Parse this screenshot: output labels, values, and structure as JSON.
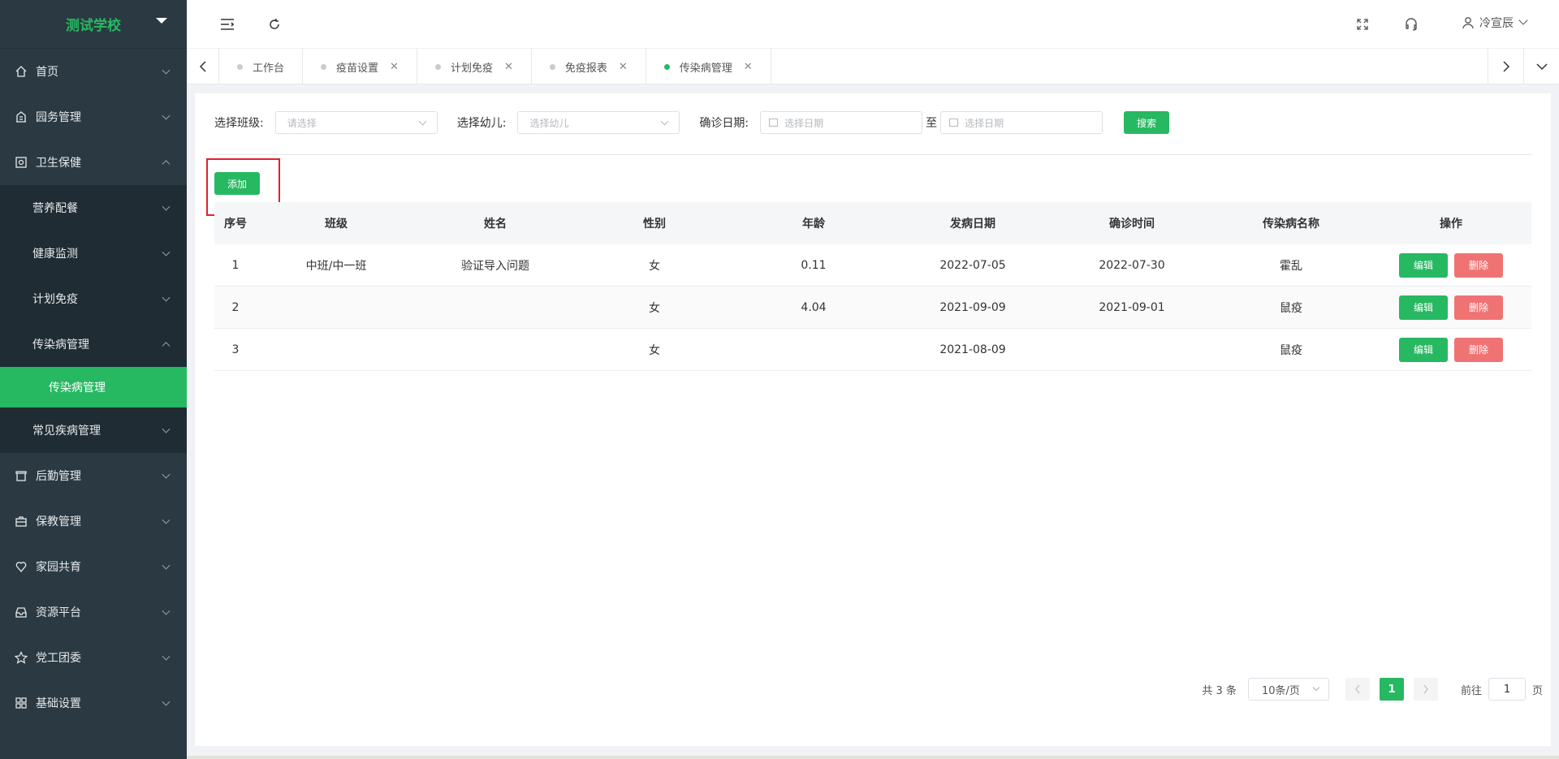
{
  "app": {
    "name": "测试学校"
  },
  "sidebar": {
    "items": [
      {
        "label": "首页",
        "icon": "home-icon"
      },
      {
        "label": "园务管理",
        "icon": "building-icon"
      },
      {
        "label": "卫生保健",
        "icon": "health-icon"
      }
    ],
    "health_sub": [
      {
        "label": "营养配餐"
      },
      {
        "label": "健康监测"
      },
      {
        "label": "计划免疫"
      },
      {
        "label": "传染病管理"
      }
    ],
    "active_sub2": "传染病管理",
    "health_sub_after": "常见疾病管理",
    "items_after": [
      {
        "label": "后勤管理",
        "icon": "store-icon"
      },
      {
        "label": "保教管理",
        "icon": "briefcase-icon"
      },
      {
        "label": "家园共育",
        "icon": "heart-pin-icon"
      },
      {
        "label": "资源平台",
        "icon": "inbox-icon"
      },
      {
        "label": "党工团委",
        "icon": "star-icon"
      },
      {
        "label": "基础设置",
        "icon": "grid-icon"
      }
    ]
  },
  "header": {
    "user_name": "冷宣辰"
  },
  "tabs": [
    {
      "label": "工作台",
      "closable": false,
      "active": false
    },
    {
      "label": "疫苗设置",
      "closable": true,
      "active": false
    },
    {
      "label": "计划免疫",
      "closable": true,
      "active": false
    },
    {
      "label": "免疫报表",
      "closable": true,
      "active": false
    },
    {
      "label": "传染病管理",
      "closable": true,
      "active": true
    }
  ],
  "filters": {
    "class_label": "选择班级:",
    "class_placeholder": "请选择",
    "child_label": "选择幼儿:",
    "child_placeholder": "选择幼儿",
    "date_label": "确诊日期:",
    "date_start_placeholder": "选择日期",
    "date_sep": "至",
    "date_end_placeholder": "选择日期",
    "search_label": "搜索"
  },
  "add_label": "添加",
  "table": {
    "headers": [
      "序号",
      "班级",
      "姓名",
      "性别",
      "年龄",
      "发病日期",
      "确诊时间",
      "传染病名称",
      "操作"
    ],
    "rows": [
      [
        "1",
        "中班/中一班",
        "验证导入问题",
        "女",
        "0.11",
        "2022-07-05",
        "2022-07-30",
        "霍乱"
      ],
      [
        "2",
        "",
        "",
        "女",
        "4.04",
        "2021-09-09",
        "2021-09-01",
        "鼠疫"
      ],
      [
        "3",
        "",
        "",
        "女",
        "",
        "2021-08-09",
        "",
        "鼠疫"
      ]
    ],
    "edit_label": "编辑",
    "delete_label": "删除"
  },
  "pagination": {
    "total": "共 3 条",
    "page_size": "10条/页",
    "current_page": "1",
    "goto_prefix": "前往",
    "goto_value": "1",
    "goto_suffix": "页"
  },
  "colors": {
    "accent": "#27b862",
    "danger": "#f07373",
    "sidebar": "#2b3a42",
    "highlight": "#e3202b"
  }
}
